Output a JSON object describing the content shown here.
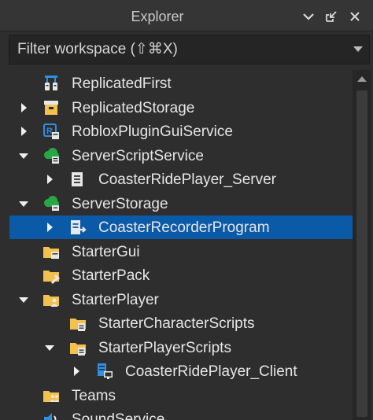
{
  "panel": {
    "title": "Explorer"
  },
  "filter": {
    "placeholder": "Filter workspace (⇧⌘X)"
  },
  "tree": [
    {
      "label": "ReplicatedFirst",
      "icon": "replicated-first-icon",
      "depth": 1,
      "arrow": "none"
    },
    {
      "label": "ReplicatedStorage",
      "icon": "replicated-storage-icon",
      "depth": 1,
      "arrow": "collapsed"
    },
    {
      "label": "RobloxPluginGuiService",
      "icon": "plugin-gui-service-icon",
      "depth": 1,
      "arrow": "collapsed"
    },
    {
      "label": "ServerScriptService",
      "icon": "server-script-service-icon",
      "depth": 1,
      "arrow": "expanded"
    },
    {
      "label": "CoasterRidePlayer_Server",
      "icon": "script-icon",
      "depth": 2,
      "arrow": "collapsed"
    },
    {
      "label": "ServerStorage",
      "icon": "server-storage-icon",
      "depth": 1,
      "arrow": "expanded"
    },
    {
      "label": "CoasterRecorderProgram",
      "icon": "module-script-icon",
      "depth": 2,
      "arrow": "collapsed",
      "selected": true
    },
    {
      "label": "StarterGui",
      "icon": "starter-gui-icon",
      "depth": 1,
      "arrow": "none"
    },
    {
      "label": "StarterPack",
      "icon": "starter-pack-icon",
      "depth": 1,
      "arrow": "none"
    },
    {
      "label": "StarterPlayer",
      "icon": "starter-player-icon",
      "depth": 1,
      "arrow": "expanded"
    },
    {
      "label": "StarterCharacterScripts",
      "icon": "starter-character-scripts-icon",
      "depth": 2,
      "arrow": "none"
    },
    {
      "label": "StarterPlayerScripts",
      "icon": "starter-player-scripts-icon",
      "depth": 2,
      "arrow": "expanded"
    },
    {
      "label": "CoasterRidePlayer_Client",
      "icon": "local-script-icon",
      "depth": 3,
      "arrow": "collapsed"
    },
    {
      "label": "Teams",
      "icon": "teams-icon",
      "depth": 1,
      "arrow": "none"
    },
    {
      "label": "SoundService",
      "icon": "sound-service-icon",
      "depth": 1,
      "arrow": "none"
    }
  ],
  "colors": {
    "selection": "#0b5aa8",
    "background": "#2e2e2e",
    "folder": "#f2c14e",
    "service_green": "#27a844",
    "service_blue": "#2f8fe0"
  }
}
